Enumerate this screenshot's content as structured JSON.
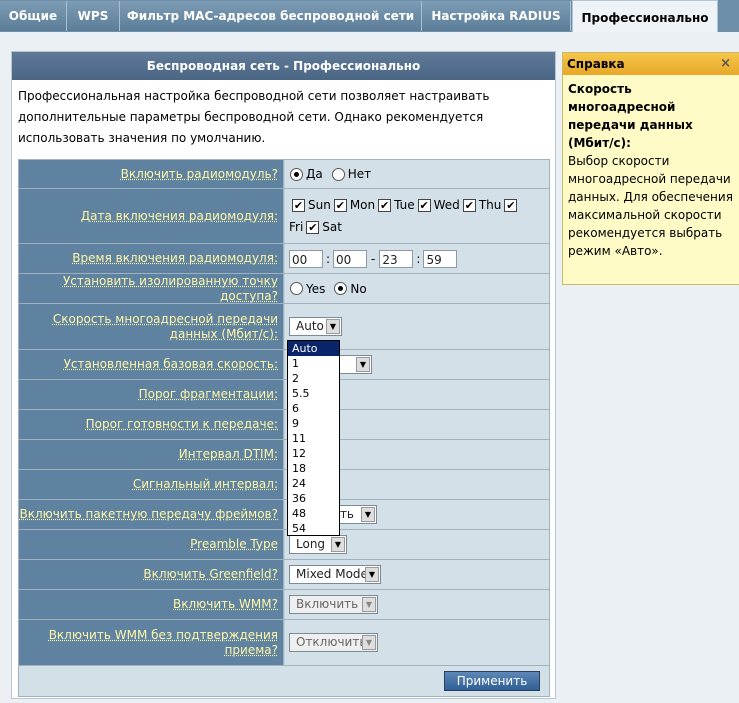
{
  "tabs": [
    {
      "label": "Общие"
    },
    {
      "label": "WPS"
    },
    {
      "label": "Фильтр MAC-адресов беспроводной сети"
    },
    {
      "label": "Настройка RADIUS"
    },
    {
      "label": "Профессионально"
    }
  ],
  "panel": {
    "title": "Беспроводная сеть - Профессионально",
    "description": "Профессиональная настройка беспроводной сети позволяет настраивать дополнительные параметры беспроводной сети. Однако рекомендуется использовать значения по умолчанию."
  },
  "rows": {
    "radio_enable": {
      "label": "Включить радиомодуль?",
      "opt_yes": "Да",
      "opt_no": "Нет"
    },
    "radio_date": {
      "label": "Дата включения радиомодуля:",
      "days": [
        "Sun",
        "Mon",
        "Tue",
        "Wed",
        "Thu",
        "Fri",
        "Sat"
      ]
    },
    "radio_time": {
      "label": "Время включения радиомодуля:",
      "h1": "00",
      "m1": "00",
      "h2": "23",
      "m2": "59",
      "sep_colon": ":",
      "sep_dash": "-"
    },
    "isolated_ap": {
      "label": "Установить изолированную точку доступа?",
      "opt_yes": "Yes",
      "opt_no": "No"
    },
    "multicast_rate": {
      "label": "Скорость многоадресной передачи данных (Мбит/с):",
      "value": "Auto"
    },
    "basic_rate": {
      "label": "Установленная базовая скорость:"
    },
    "frag": {
      "label": "Порог фрагментации:"
    },
    "rts": {
      "label": "Порог готовности к передаче:"
    },
    "dtim": {
      "label": "Интервал DTIM:"
    },
    "beacon": {
      "label": "Сигнальный интервал:"
    },
    "frameburst": {
      "label": "Включить пакетную передачу фреймов?",
      "value": "ть"
    },
    "preamble": {
      "label": "Preamble Type",
      "value": "Long"
    },
    "greenfield": {
      "label": "Включить Greenfield?",
      "value": "Mixed Mode"
    },
    "wmm": {
      "label": "Включить WMM?",
      "value": "Включить"
    },
    "wmm_noack": {
      "label": "Включить WMM без подтверждения приема?",
      "value": "Отключить"
    }
  },
  "dropdown_options": [
    "Auto",
    "1",
    "2",
    "5.5",
    "6",
    "9",
    "11",
    "12",
    "18",
    "24",
    "36",
    "48",
    "54"
  ],
  "apply_button": "Применить",
  "help": {
    "header": "Справка",
    "close": "×",
    "title": "Скорость многоадресной передачи данных (Мбит/с):",
    "body": "Выбор скорости многоадресной передачи данных. Для обеспечения максимальной скорости рекомендуется выбрать режим «Авто»."
  },
  "colors": {
    "tab_bg": "#6e8fa9",
    "label_bg": "#5f82a1",
    "label_text": "#fff7a8",
    "help_bg": "#fffbc7"
  }
}
